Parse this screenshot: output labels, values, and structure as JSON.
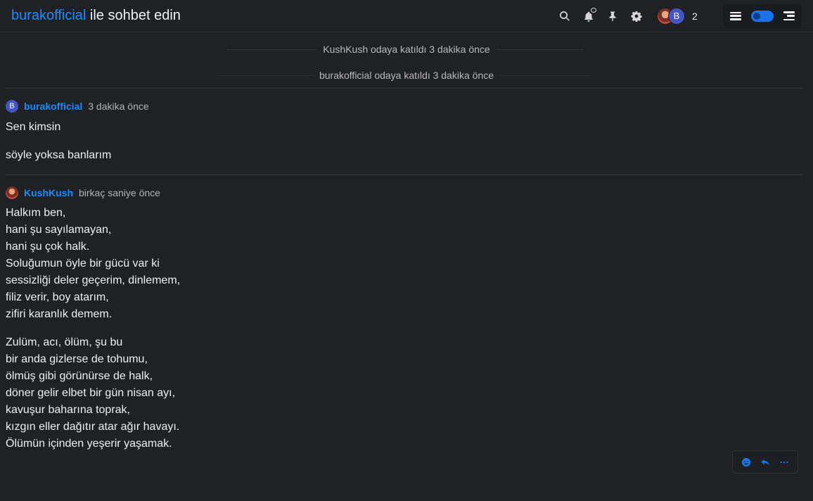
{
  "header": {
    "room_user": "burakofficial",
    "title_suffix": " ile sohbet edin",
    "participant_count": "2",
    "avatar_b_letter": "B"
  },
  "system_messages": [
    "KushKush odaya katıldı 3 dakika önce",
    "burakofficial odaya katıldı 3 dakika önce"
  ],
  "messages": [
    {
      "avatar_letter": "B",
      "username": "burakofficial",
      "time": "3 dakika önce",
      "paragraphs": [
        [
          "Sen kimsin"
        ],
        [
          "söyle yoksa banlarım"
        ]
      ]
    },
    {
      "username": "KushKush",
      "time": "birkaç saniye önce",
      "paragraphs": [
        [
          "Halkım ben,",
          "hani şu sayılamayan,",
          "hani şu çok halk.",
          "Soluğumun öyle bir gücü var ki",
          "sessizliği deler geçerim, dinlemem,",
          "filiz verir, boy atarım,",
          "zifiri karanlık demem."
        ],
        [
          "Zulüm, acı, ölüm, şu bu",
          "bir anda gizlerse de tohumu,",
          "ölmüş gibi görünürse de halk,",
          "döner gelir elbet bir gün nisan ayı,",
          "kavuşur baharına toprak,",
          "kızgın eller dağıtır atar ağır havayı.",
          "Ölümün içinden yeşerir yaşamak."
        ]
      ]
    }
  ],
  "colors": {
    "accent": "#1a8cff",
    "background": "#202124"
  }
}
